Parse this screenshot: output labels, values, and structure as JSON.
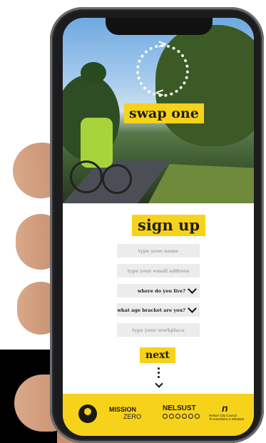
{
  "hero": {
    "title": "swap one",
    "swap_icon": "swap-arrows-icon"
  },
  "form": {
    "title": "sign up",
    "name_placeholder": "type your name",
    "email_placeholder": "type your email address",
    "location_label": "where do you live?",
    "age_label": "what age bracket are you?",
    "workplace_placeholder": "type your workplace",
    "next_label": "next"
  },
  "footer": {
    "mission_line1": "MISSION",
    "mission_line2": "ZERO",
    "nelsust": "NELSUST",
    "council_line1": "Nelson City Council",
    "council_line2": "Te Kaunihera o Whakatū"
  },
  "colors": {
    "accent_yellow": "#f7d21a",
    "field_gray": "#ececec",
    "text_dark": "#1f1f1f"
  }
}
